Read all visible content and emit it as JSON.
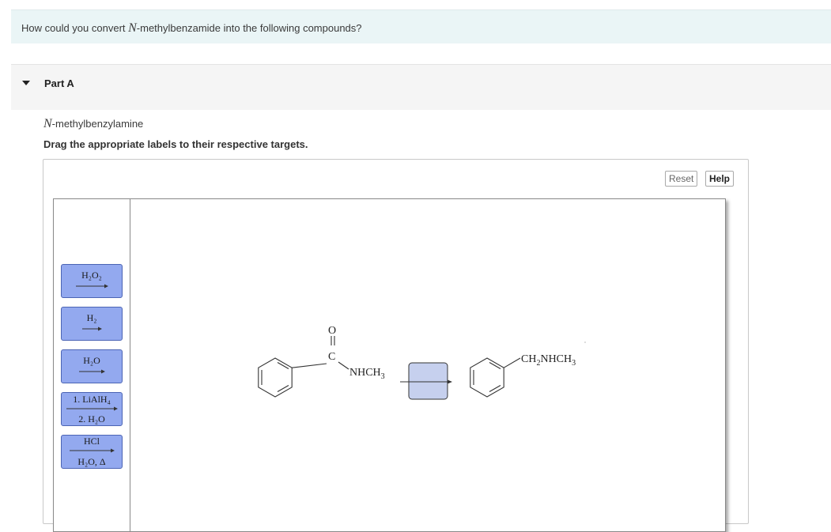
{
  "question": {
    "prefix": "How could you convert ",
    "italic": "N",
    "suffix": "-methylbenzamide into the following compounds?"
  },
  "part": {
    "title": "Part A"
  },
  "target": {
    "italic": "N",
    "suffix": "-methylbenzylamine"
  },
  "instruction": "Drag the appropriate labels to their respective targets.",
  "buttons": {
    "reset": "Reset",
    "help": "Help"
  },
  "labels": [
    {
      "top": "H₂O₂",
      "bottom": ""
    },
    {
      "top": "H₂",
      "bottom": ""
    },
    {
      "top": "H₂O",
      "bottom": ""
    },
    {
      "top": "1. LiAlH₄",
      "bottom": "2. H₂O"
    },
    {
      "top": "HCl",
      "bottom": "H₂O, Δ"
    }
  ],
  "scheme": {
    "reactant_oxygen": "O",
    "reactant_carbon": "C",
    "reactant_group": "NHCH",
    "reactant_group_sub": "3",
    "product_group_a": "CH",
    "product_group_a_sub": "2",
    "product_group_b": "NHCH",
    "product_group_b_sub": "3"
  },
  "colors": {
    "label_fill": "#93a9ef",
    "label_border": "#4b64b4",
    "dropzone_fill": "#c6d0ee"
  }
}
